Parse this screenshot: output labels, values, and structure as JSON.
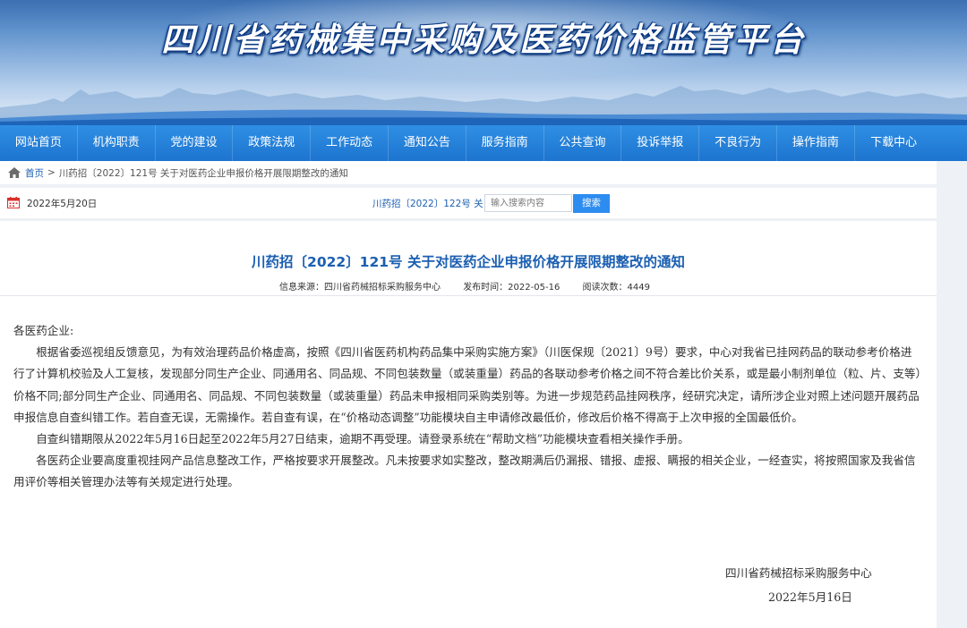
{
  "banner": {
    "title": "四川省药械集中采购及医药价格监管平台"
  },
  "nav": {
    "items": [
      {
        "label": "网站首页"
      },
      {
        "label": "机构职责"
      },
      {
        "label": "党的建设"
      },
      {
        "label": "政策法规"
      },
      {
        "label": "工作动态"
      },
      {
        "label": "通知公告"
      },
      {
        "label": "服务指南"
      },
      {
        "label": "公共查询"
      },
      {
        "label": "投诉举报"
      },
      {
        "label": "不良行为"
      },
      {
        "label": "操作指南"
      },
      {
        "label": "下载中心"
      }
    ]
  },
  "breadcrumb": {
    "home": "首页",
    "separator": ">",
    "current": "川药招〔2022〕121号 关于对医药企业申报价格开展限期整改的通知"
  },
  "infobar": {
    "date": "2022年5月20日",
    "marquee": "川药招〔2022〕122号 关",
    "search_placeholder": "输入搜索内容",
    "search_button": "搜索"
  },
  "article": {
    "title": "川药招〔2022〕121号 关于对医药企业申报价格开展限期整改的通知",
    "meta": {
      "source": "信息来源：四川省药械招标采购服务中心",
      "published": "发布时间：2022-05-16",
      "views": "阅读次数：4449"
    },
    "salutation": "各医药企业:",
    "paragraphs": [
      "根据省委巡视组反馈意见，为有效治理药品价格虚高，按照《四川省医药机构药品集中采购实施方案》（川医保规〔2021〕9号）要求，中心对我省已挂网药品的联动参考价格进行了计算机校验及人工复核，发现部分同生产企业、同通用名、同品规、不同包装数量（或装重量）药品的各联动参考价格之间不符合差比价关系，或是最小制剂单位（粒、片、支等）价格不同;部分同生产企业、同通用名、同品规、不同包装数量（或装重量）药品未申报相同采购类别等。为进一步规范药品挂网秩序，经研究决定，请所涉企业对照上述问题开展药品申报信息自查纠错工作。若自查无误，无需操作。若自查有误，在“价格动态调整”功能模块自主申请修改最低价，修改后价格不得高于上次申报的全国最低价。",
      "自查纠错期限从2022年5月16日起至2022年5月27日结束，逾期不再受理。请登录系统在“帮助文档”功能模块查看相关操作手册。",
      "各医药企业要高度重视挂网产品信息整改工作，严格按要求开展整改。凡未按要求如实整改，整改期满后仍漏报、错报、虚报、瞒报的相关企业，一经查实，将按照国家及我省信用评价等相关管理办法等有关规定进行处理。"
    ],
    "signature_org": "四川省药械招标采购服务中心",
    "signature_date": "2022年5月16日"
  },
  "colors": {
    "nav_bg": "#1d74cf",
    "title_blue": "#1b5fb1",
    "search_button": "#2d8cf0"
  }
}
